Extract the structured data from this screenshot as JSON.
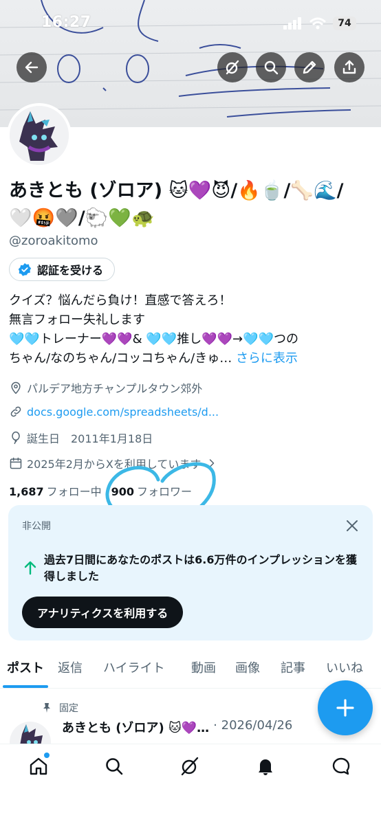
{
  "status": {
    "time": "16:27",
    "battery": "74"
  },
  "profile": {
    "name_line1": "あきとも (ゾロア) 🐱💜😈/🔥🍵/🦴🌊/",
    "name_line2": "🤍🤬🩶/🐑💚🐢",
    "handle": "@zoroakitomo",
    "verify_label": "認証を受ける",
    "bio": {
      "line1": "クイズ？悩んだら負け！直感で答えろ！",
      "line2": "無言フォロー失礼します",
      "line3": "🩵🩵トレーナー💜💜& 🩵🩵推し💜💜→🩵🩵つの",
      "line4": "ちゃん/なのちゃん/コッコちゃん/きゅ…",
      "more": "さらに表示"
    },
    "location": "パルデア地方チャンプルタウン郊外",
    "link": "docs.google.com/spreadsheets/d...",
    "birthday": "誕生日　2011年1月18日",
    "joined": "2025年2月からXを利用しています",
    "following_count": "1,687",
    "following_label": "フォロー中",
    "followers_count": "900",
    "followers_label": "フォロワー"
  },
  "card": {
    "private_label": "非公開",
    "text": "過去7日間にあなたのポストは6.6万件のインプレッションを獲得しました",
    "button": "アナリティクスを利用する"
  },
  "tabs": [
    "ポスト",
    "返信",
    "ハイライト",
    "動画",
    "画像",
    "記事",
    "いいね"
  ],
  "post": {
    "pinned_label": "固定",
    "author": "あきとも (ゾロア) 🐱💜…",
    "meta": "· 2026/04/26"
  },
  "colors": {
    "accent": "#1d9bf0",
    "text": "#0f1419",
    "muted": "#536471",
    "card_bg": "#e8f5fd"
  }
}
